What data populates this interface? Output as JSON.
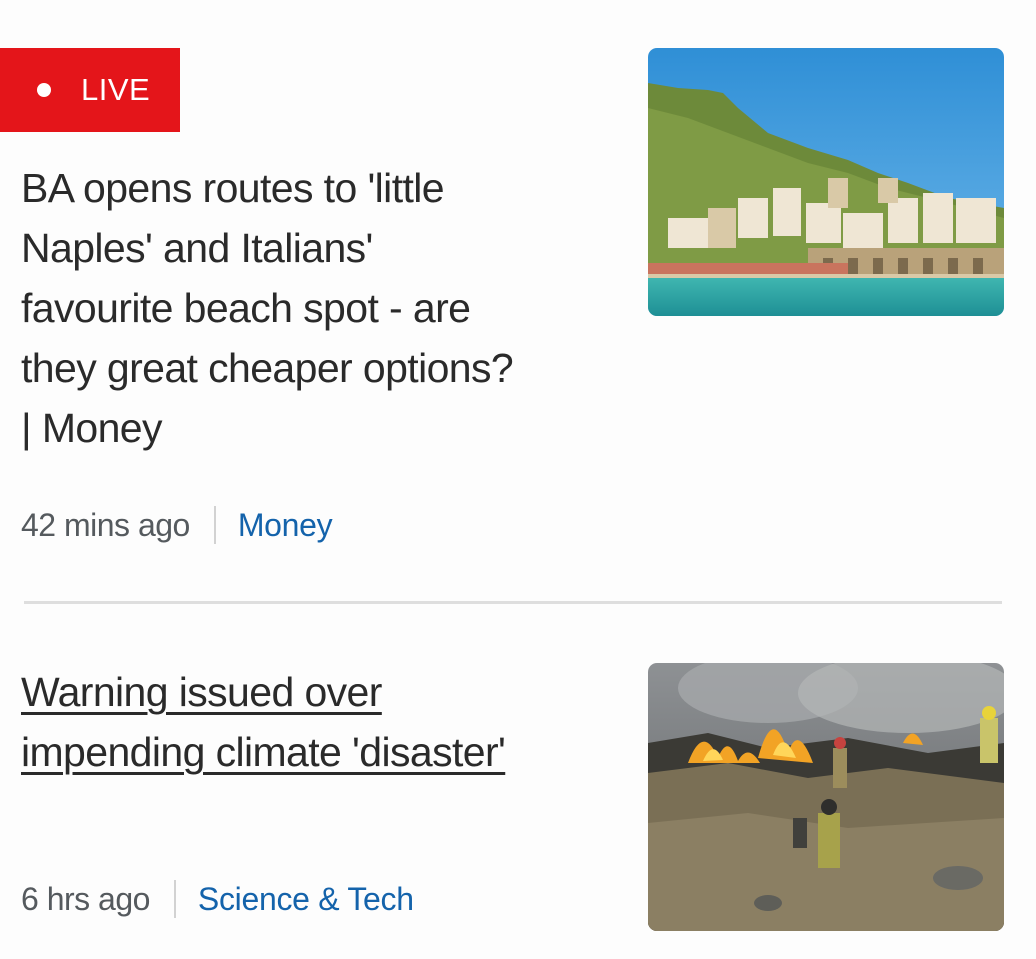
{
  "articles": [
    {
      "badge": "LIVE",
      "title_lines": [
        "BA opens routes to 'little",
        "Naples' and Italians'",
        "favourite beach spot - are",
        "they great cheaper options?",
        "| Money"
      ],
      "time": "42 mins ago",
      "section": "Money",
      "image_alt": "coastal-town-photo"
    },
    {
      "title_lines": [
        "Warning issued over",
        "impending climate 'disaster'"
      ],
      "time": "6 hrs ago",
      "section": "Science & Tech",
      "image_alt": "wildfire-photo"
    }
  ],
  "colors": {
    "live_red": "#e4151a",
    "section_blue": "#1463ab",
    "text": "#2a2a2a",
    "meta_grey": "#555a5e"
  }
}
